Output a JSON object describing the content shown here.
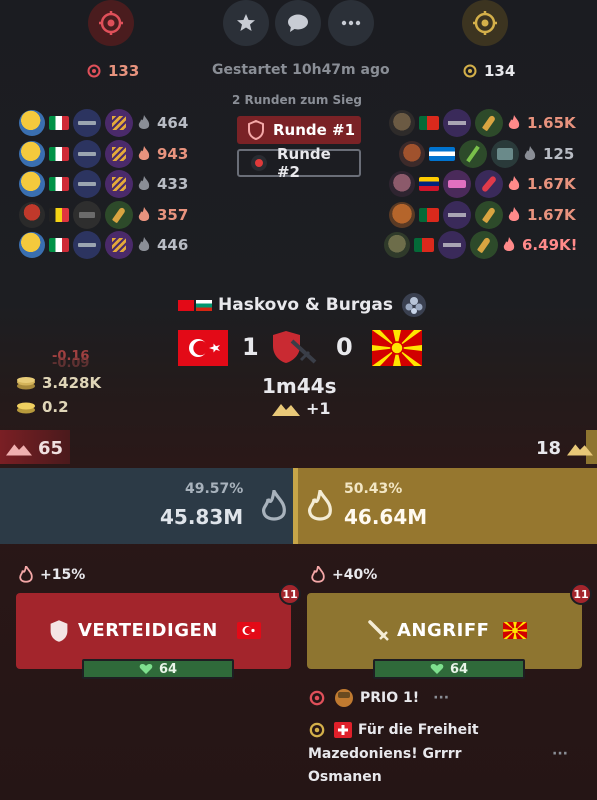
{
  "top": {
    "left_count": "133",
    "right_count": "134",
    "started": "Gestartet 10h47m ago",
    "rounds_to_win": "2 Runden zum Sieg"
  },
  "rounds": [
    "Runde #1",
    "Runde #2"
  ],
  "left_team": [
    {
      "value": "464"
    },
    {
      "value": "943"
    },
    {
      "value": "433"
    },
    {
      "value": "357"
    },
    {
      "value": "446"
    }
  ],
  "right_team": [
    {
      "value": "1.65K"
    },
    {
      "value": "125"
    },
    {
      "value": "1.67K"
    },
    {
      "value": "1.67K"
    },
    {
      "value": "6.49K!"
    }
  ],
  "battle": {
    "title": "Haskovo & Burgas",
    "score_left": "1",
    "score_right": "0",
    "timer": "1m44s",
    "bonus": "+1"
  },
  "stats": {
    "delta_1": "-0.16",
    "delta_2": "-0.09",
    "coins": "3.428K",
    "rate": "0.2"
  },
  "territory": {
    "left": "65",
    "right": "18"
  },
  "damage": {
    "left_pct": "49.57%",
    "left_total": "45.83M",
    "right_pct": "50.43%",
    "right_total": "46.64M"
  },
  "actions": {
    "defend_bonus": "+15%",
    "defend_label": "VERTEIDIGEN",
    "defend_badge": "11",
    "defend_health": "64",
    "attack_bonus": "+40%",
    "attack_label": "ANGRIFF",
    "attack_badge": "11",
    "attack_health": "64"
  },
  "messages": {
    "prio": "PRIO 1!",
    "slogan_1": "Für die Freiheit",
    "slogan_2": "Mazedoniens! Grrrr",
    "slogan_3": "Osmanen",
    "more": "···"
  },
  "colors": {
    "defend": "#a3252c",
    "attack": "#8e7530",
    "accent_gold": "#c7a548",
    "accent_red": "#e0505a"
  }
}
